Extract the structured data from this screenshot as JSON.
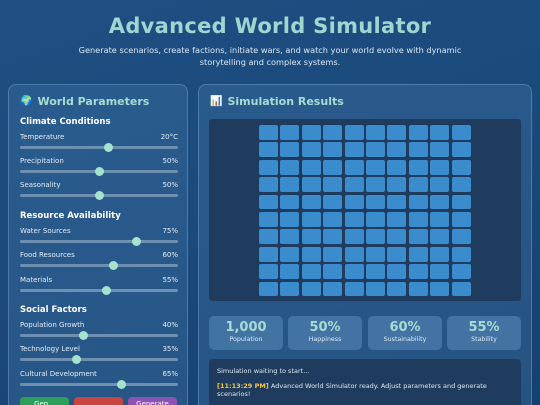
{
  "header": {
    "title": "Advanced World Simulator",
    "subtitle": "Generate scenarios, create factions, initiate wars, and watch your world evolve with dynamic storytelling and complex systems."
  },
  "parameters": {
    "title": "World Parameters",
    "emoji": "🌍",
    "sections": [
      {
        "title": "Climate Conditions"
      },
      {
        "title": "Resource Availability"
      },
      {
        "title": "Social Factors"
      }
    ],
    "sliders": [
      {
        "label": "Temperature",
        "value": "20°C",
        "level": 0.56
      },
      {
        "label": "Precipitation",
        "value": "50%",
        "level": 0.5
      },
      {
        "label": "Seasonality",
        "value": "50%",
        "level": 0.5
      },
      {
        "label": "Water Sources",
        "value": "75%",
        "level": 0.74
      },
      {
        "label": "Food Resources",
        "value": "60%",
        "level": 0.59
      },
      {
        "label": "Materials",
        "value": "55%",
        "level": 0.55
      },
      {
        "label": "Population Growth",
        "value": "40%",
        "level": 0.4
      },
      {
        "label": "Technology Level",
        "value": "35%",
        "level": 0.36
      },
      {
        "label": "Cultural Development",
        "value": "65%",
        "level": 0.64
      }
    ],
    "buttons": [
      {
        "label": "Gen...",
        "color": "#2e9e5b"
      },
      {
        "label": "",
        "color": "#c9453f"
      },
      {
        "label": "Generate",
        "color": "#8e52b5"
      }
    ]
  },
  "results": {
    "title": "Simulation Results",
    "emoji": "📊",
    "stats": [
      {
        "value": "1,000",
        "label": "Population"
      },
      {
        "value": "50%",
        "label": "Happiness"
      },
      {
        "value": "60%",
        "label": "Sustainability"
      },
      {
        "value": "55%",
        "label": "Stability"
      }
    ],
    "log": {
      "status": "Simulation waiting to start...",
      "time": "[11:13:29 PM]",
      "message": "Advanced World Simulator ready. Adjust parameters and generate scenarios!"
    }
  }
}
